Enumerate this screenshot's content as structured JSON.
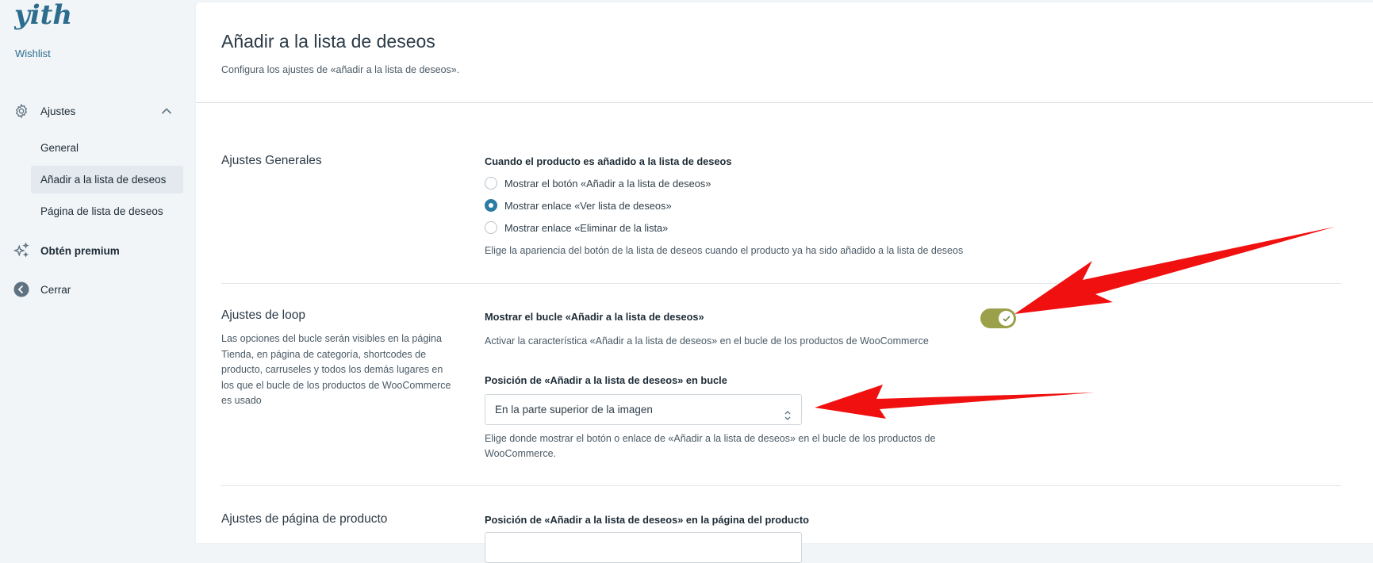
{
  "sidebar": {
    "logo_text": "yith",
    "product": "Wishlist",
    "settings_label": "Ajustes",
    "settings_icon": "gear-icon",
    "items": [
      {
        "label": "General",
        "active": false
      },
      {
        "label": "Añadir a la lista de deseos",
        "active": true
      },
      {
        "label": "Página de lista de deseos",
        "active": false
      }
    ],
    "premium_label": "Obtén premium",
    "premium_icon": "sparkle-icon",
    "close_label": "Cerrar",
    "close_icon": "arrow-left-circle-icon"
  },
  "page": {
    "title": "Añadir a la lista de deseos",
    "description": "Configura los ajustes de «añadir a la lista de deseos»."
  },
  "general_section": {
    "title": "Ajustes Generales",
    "field_label": "Cuando el producto es añadido a la lista de deseos",
    "options": [
      {
        "label": "Mostrar el botón «Añadir a la lista de deseos»",
        "checked": false
      },
      {
        "label": "Mostrar enlace «Ver lista de deseos»",
        "checked": true
      },
      {
        "label": "Mostrar enlace «Eliminar de la lista»",
        "checked": false
      }
    ],
    "help": "Elige la apariencia del botón de la lista de deseos cuando el producto ya ha sido añadido a la lista de deseos"
  },
  "loop_section": {
    "title": "Ajustes de loop",
    "description": "Las opciones del bucle serán visibles en la página Tienda, en página de categoría, shortcodes de producto, carruseles y todos los demás lugares en los que el bucle de los productos de WooCommerce es usado",
    "toggle_label": "Mostrar el bucle «Añadir a la lista de deseos»",
    "toggle_on": true,
    "toggle_help": "Activar la característica «Añadir a la lista de deseos» en el bucle de los productos de WooCommerce",
    "position_label": "Posición de «Añadir a la lista de deseos» en bucle",
    "position_value": "En la parte superior de la imagen",
    "position_help": "Elige donde mostrar el botón o enlace de «Añadir a la lista de deseos» en el bucle de los productos de WooCommerce."
  },
  "product_section": {
    "title": "Ajustes de página de producto",
    "position_label": "Posición de «Añadir a la lista de deseos» en la página del producto"
  },
  "colors": {
    "accent": "#2a7ca3",
    "toggle_on": "#9aa14a",
    "annotation_arrow": "#f01010"
  }
}
